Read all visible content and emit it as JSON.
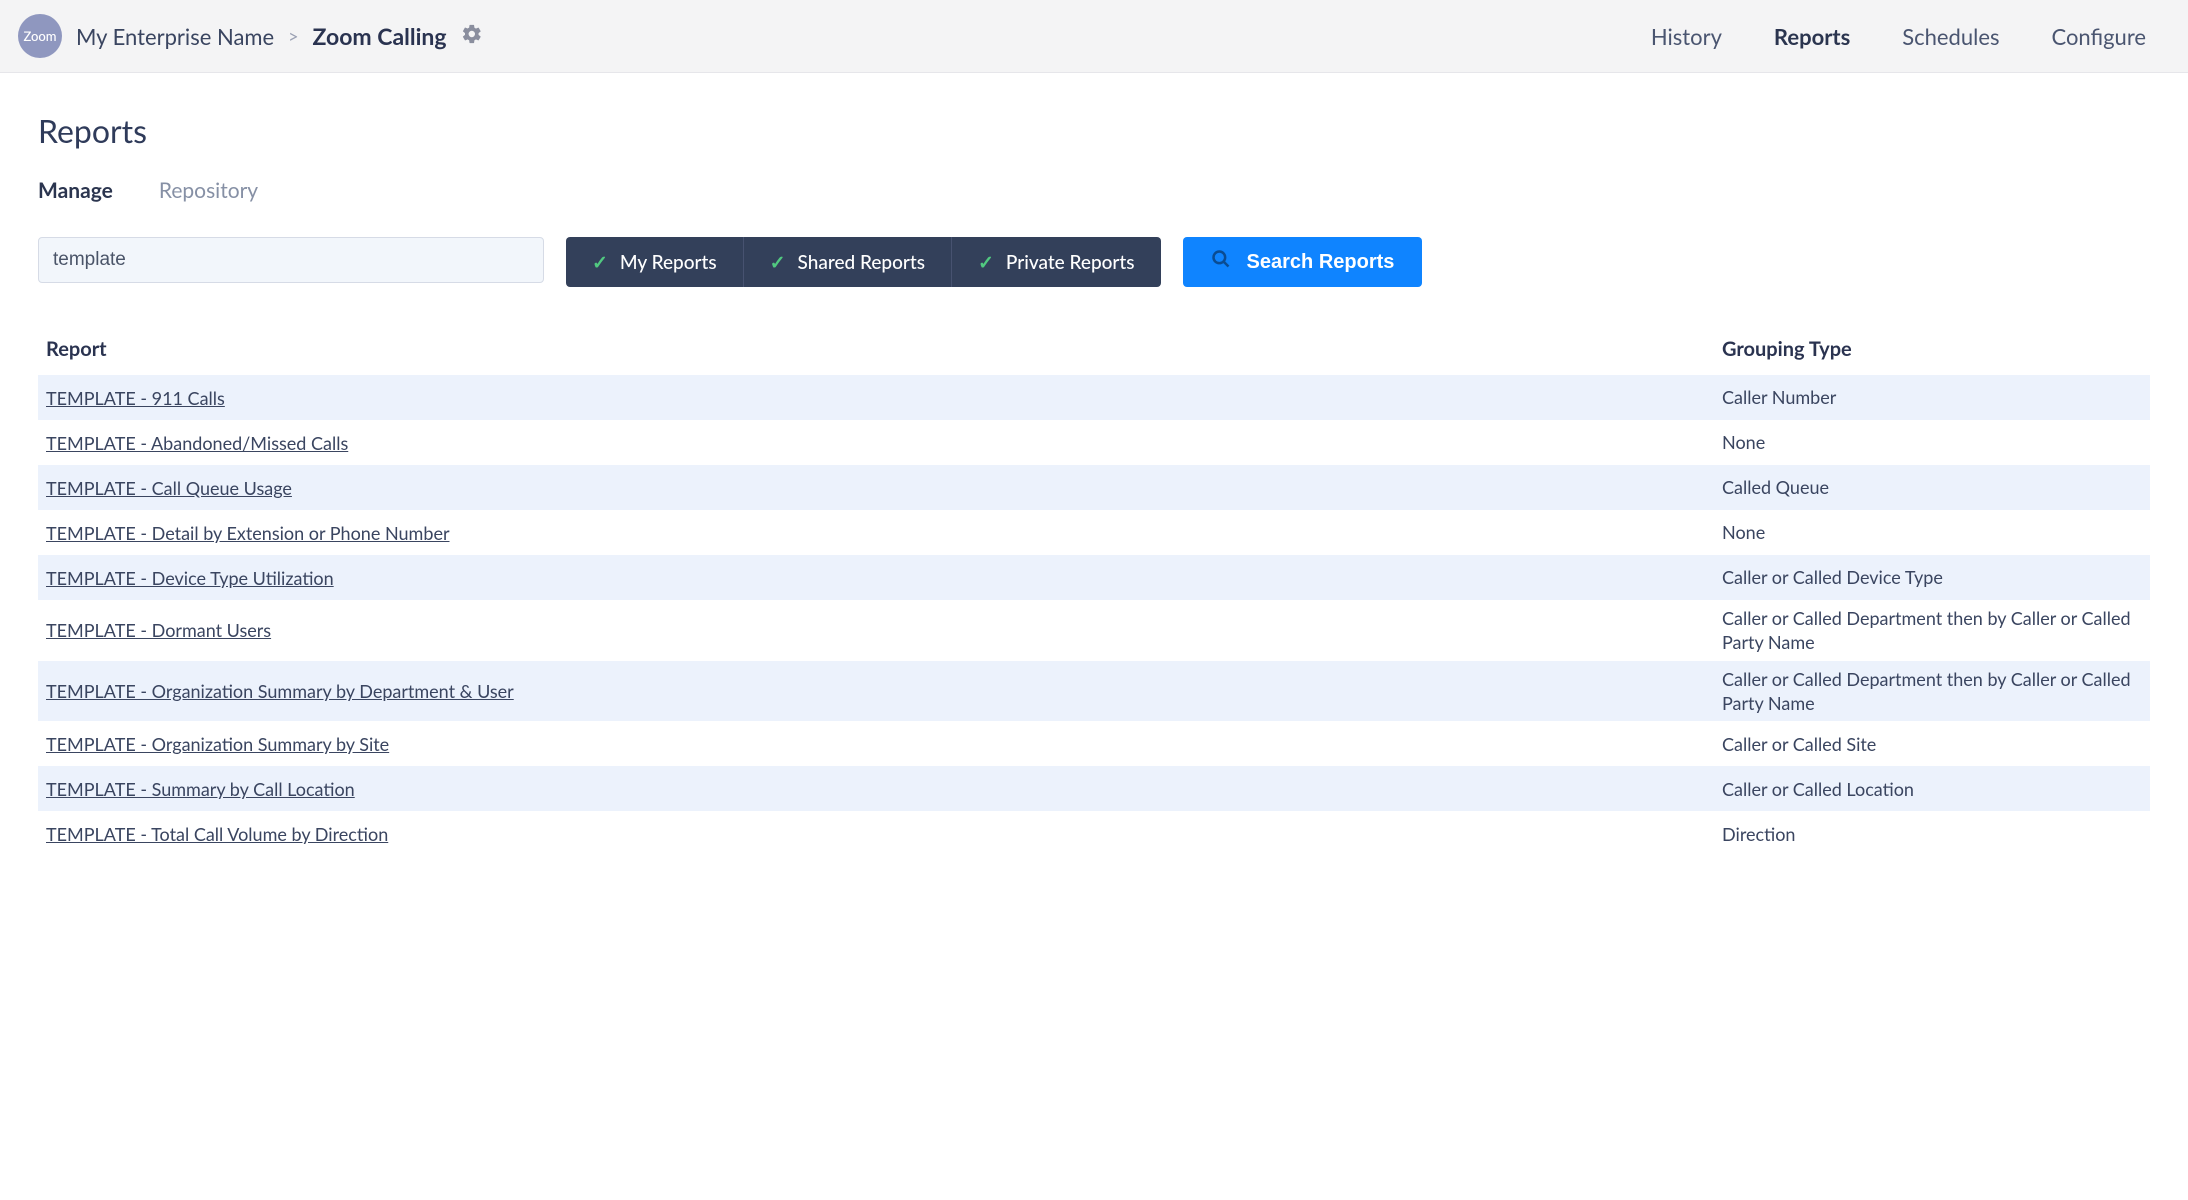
{
  "header": {
    "badge": "Zoom",
    "enterprise": "My Enterprise Name",
    "sep": ">",
    "app": "Zoom Calling",
    "gear_icon": "gear"
  },
  "nav": {
    "items": [
      "History",
      "Reports",
      "Schedules",
      "Configure"
    ],
    "active": "Reports"
  },
  "page": {
    "title": "Reports"
  },
  "subtabs": {
    "items": [
      "Manage",
      "Repository"
    ],
    "active": "Manage"
  },
  "search": {
    "value": "template"
  },
  "toggles": {
    "my": "My Reports",
    "shared": "Shared Reports",
    "private": "Private Reports"
  },
  "search_button": "Search Reports",
  "table": {
    "headers": {
      "report": "Report",
      "grouping": "Grouping Type"
    },
    "rows": [
      {
        "name": "TEMPLATE - 911 Calls",
        "grouping": "Caller Number"
      },
      {
        "name": "TEMPLATE - Abandoned/Missed Calls",
        "grouping": "None"
      },
      {
        "name": "TEMPLATE - Call Queue Usage",
        "grouping": "Called Queue"
      },
      {
        "name": "TEMPLATE - Detail by Extension or Phone Number",
        "grouping": "None"
      },
      {
        "name": "TEMPLATE - Device Type Utilization",
        "grouping": "Caller or Called Device Type"
      },
      {
        "name": "TEMPLATE - Dormant Users",
        "grouping": "Caller or Called Department then by Caller or Called Party Name"
      },
      {
        "name": "TEMPLATE - Organization Summary by Department & User",
        "grouping": "Caller or Called Department then by Caller or Called Party Name"
      },
      {
        "name": "TEMPLATE - Organization Summary by Site",
        "grouping": "Caller or Called Site"
      },
      {
        "name": "TEMPLATE - Summary by Call Location",
        "grouping": "Caller or Called Location"
      },
      {
        "name": "TEMPLATE - Total Call Volume by Direction",
        "grouping": "Direction"
      }
    ]
  }
}
